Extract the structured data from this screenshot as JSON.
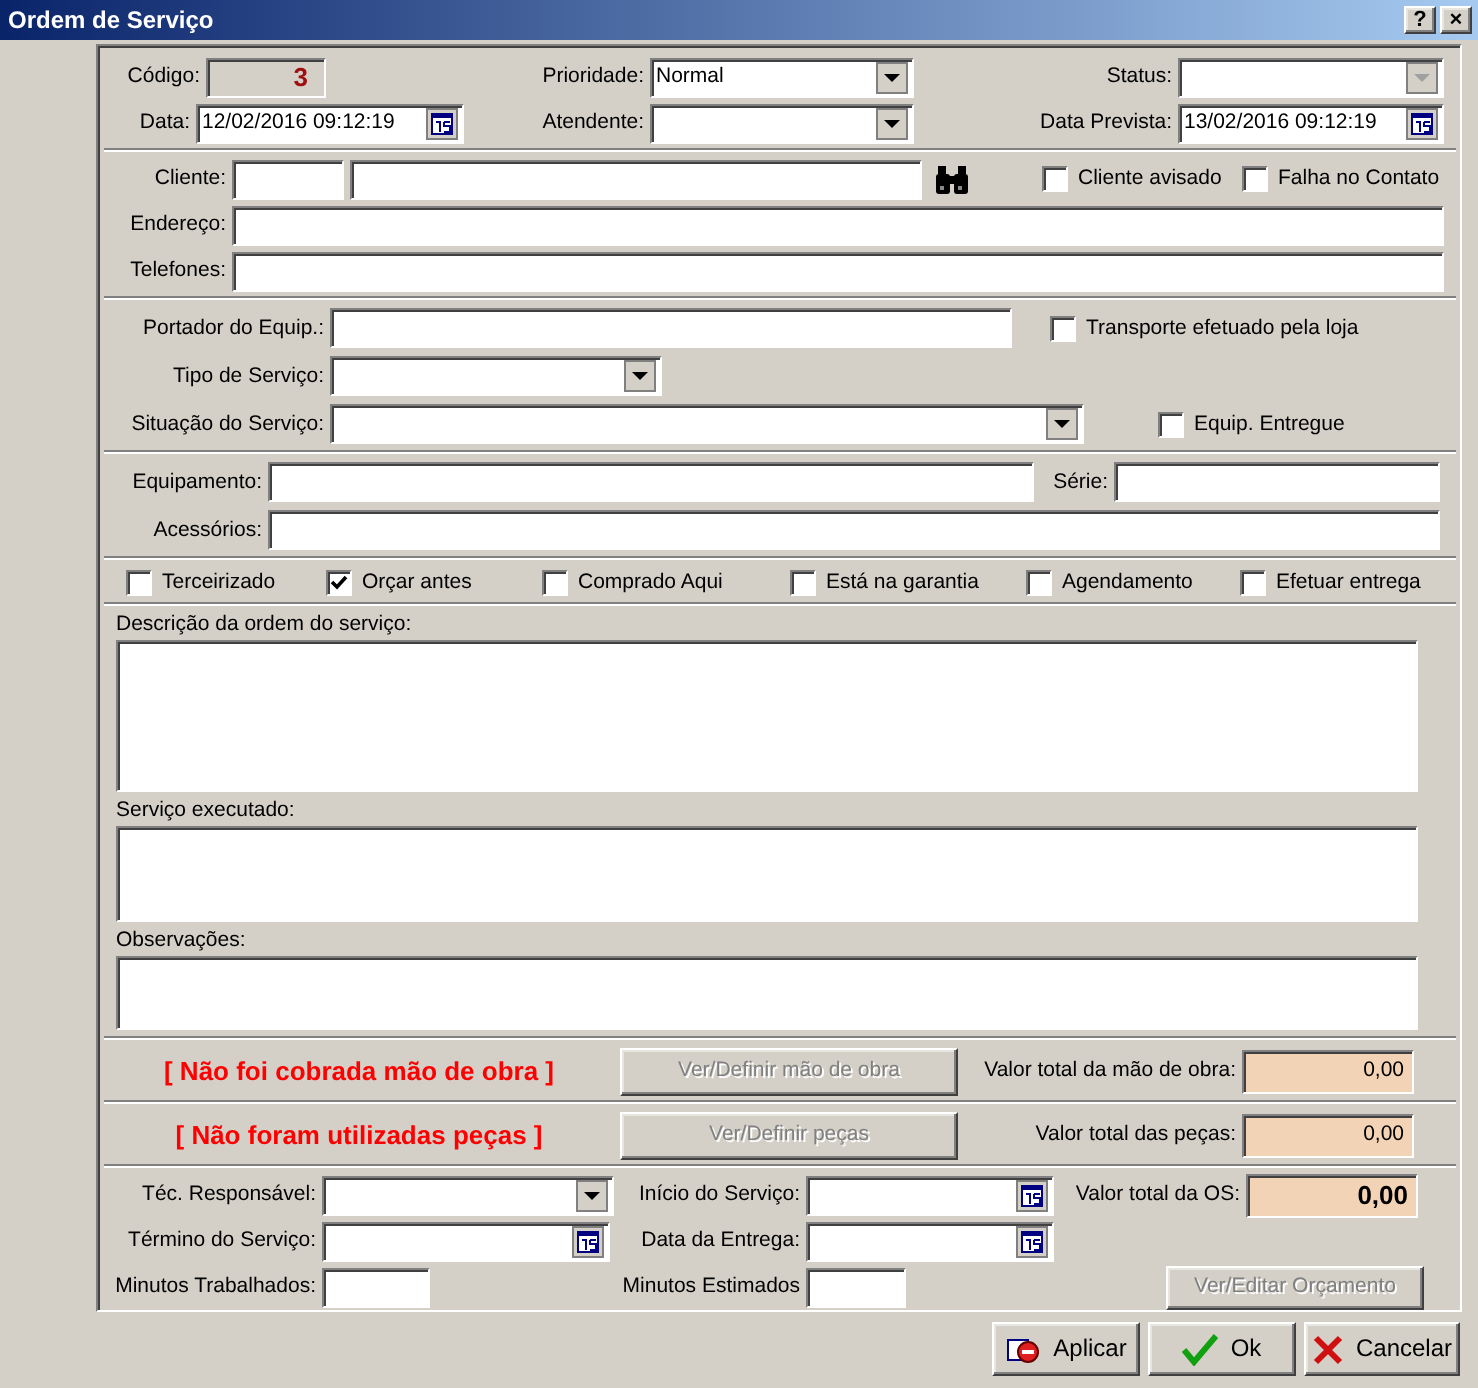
{
  "window": {
    "title": "Ordem de Serviço",
    "help_button": "?",
    "close_button": "×"
  },
  "sections": [
    {
      "rows": [
        [
          {
            "kind": "code",
            "label": "Código:",
            "value": "3"
          },
          {
            "kind": "combo",
            "label": "Prioridade:",
            "value": "Normal",
            "disabled": false
          },
          {
            "kind": "combo",
            "label": "Status:",
            "disabled": true
          }
        ],
        [
          {
            "kind": "date",
            "label": "Data:",
            "value": "12/02/2016 09:12:19"
          },
          {
            "kind": "combo",
            "label": "Atendente:",
            "disabled": false
          },
          {
            "kind": "date",
            "label": "Data Prevista:",
            "value": "13/02/2016 09:12:19"
          }
        ]
      ]
    },
    {
      "rows": [
        [
          {
            "kind": "text",
            "label": "Cliente:"
          },
          {
            "kind": "text"
          },
          {
            "kind": "finder"
          },
          {
            "kind": "check",
            "label": "Cliente avisado",
            "checked": false
          },
          {
            "kind": "check",
            "label": "Falha no Contato",
            "checked": false
          }
        ],
        [
          {
            "kind": "text",
            "label": "Endereço:"
          }
        ],
        [
          {
            "kind": "text",
            "label": "Telefones:"
          }
        ]
      ]
    },
    {
      "rows": [
        [
          {
            "kind": "text",
            "label": "Portador do Equip.:"
          },
          {
            "kind": "check",
            "label": "Transporte efetuado pela loja",
            "checked": false
          }
        ],
        [
          {
            "kind": "combo",
            "label": "Tipo de Serviço:",
            "disabled": false
          }
        ],
        [
          {
            "kind": "combo",
            "label": "Situação do Serviço:",
            "disabled": false
          },
          {
            "kind": "check",
            "label": "Equip. Entregue",
            "checked": false
          }
        ]
      ]
    },
    {
      "rows": [
        [
          {
            "kind": "text",
            "label": "Equipamento:"
          },
          {
            "kind": "text",
            "label": "Série:"
          }
        ],
        [
          {
            "kind": "text",
            "label": "Acessórios:"
          }
        ]
      ]
    },
    {
      "rows": [
        [
          {
            "kind": "check",
            "label": "Terceirizado",
            "checked": false
          },
          {
            "kind": "check",
            "label": "Orçar antes",
            "checked": true
          },
          {
            "kind": "check",
            "label": "Comprado Aqui",
            "checked": false
          },
          {
            "kind": "check",
            "label": "Está na garantia",
            "checked": false
          },
          {
            "kind": "check",
            "label": "Agendamento",
            "checked": false
          },
          {
            "kind": "check",
            "label": "Efetuar entrega",
            "checked": false
          }
        ]
      ]
    },
    {
      "memos": [
        {
          "label": "Descrição da ordem do serviço:"
        },
        {
          "label": "Serviço executado:"
        },
        {
          "label": "Observações:"
        }
      ]
    },
    {
      "note": "[ Não foi cobrada mão de obra ]",
      "button": {
        "label": "Ver/Definir mão de obra",
        "disabled": true
      },
      "total_label": "Valor total da mão de obra:",
      "total": "0,00"
    },
    {
      "note": "[ Não foram utilizadas peças ]",
      "button": {
        "label": "Ver/Definir peças",
        "disabled": true
      },
      "total_label": "Valor total das peças:",
      "total": "0,00"
    },
    {
      "rows": [
        [
          {
            "kind": "combo",
            "label": "Téc. Responsável:",
            "disabled": false
          },
          {
            "kind": "date",
            "label": "Início do Serviço:"
          },
          {
            "kind": "total",
            "label": "Valor total da OS:",
            "value": "0,00"
          }
        ],
        [
          {
            "kind": "date",
            "label": "Término do Serviço:"
          },
          {
            "kind": "date",
            "label": "Data da Entrega:"
          }
        ],
        [
          {
            "kind": "text",
            "label": "Minutos Trabalhados:"
          },
          {
            "kind": "text",
            "label": "Minutos Estimados"
          },
          {
            "kind": "button",
            "label": "Ver/Editar Orçamento",
            "disabled": true
          }
        ]
      ]
    }
  ],
  "actions": [
    {
      "kind": "apply",
      "label": "Aplicar"
    },
    {
      "kind": "ok",
      "label": "Ok"
    },
    {
      "kind": "cancel",
      "label": "Cancelar"
    }
  ]
}
